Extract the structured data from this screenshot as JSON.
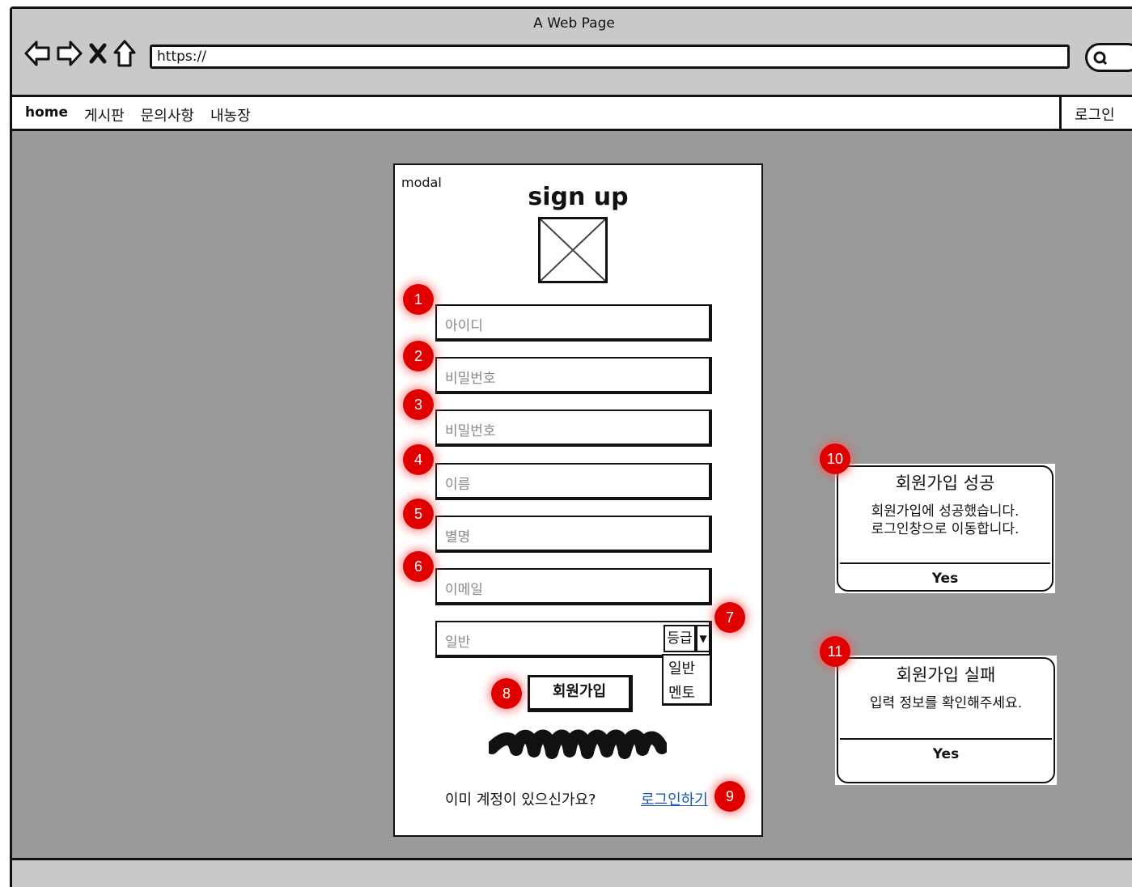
{
  "window": {
    "title": "A Web Page",
    "url": "https://"
  },
  "nav": {
    "items": [
      "home",
      "게시판",
      "문의사항",
      "내농장"
    ],
    "login": "로그인",
    "more": "..."
  },
  "modal": {
    "tag": "modal",
    "title": "sign up",
    "fields": [
      {
        "badge": "1",
        "placeholder": "아이디"
      },
      {
        "badge": "2",
        "placeholder": "비밀번호"
      },
      {
        "badge": "3",
        "placeholder": "비밀번호"
      },
      {
        "badge": "4",
        "placeholder": "이름"
      },
      {
        "badge": "5",
        "placeholder": "별명"
      },
      {
        "badge": "6",
        "placeholder": "이메일"
      }
    ],
    "grade": {
      "badge": "7",
      "value": "일반",
      "button": "등급",
      "options": [
        "일반",
        "멘토"
      ]
    },
    "signup_button": {
      "badge": "8",
      "label": "회원가입"
    },
    "footer": {
      "badge": "9",
      "question": "이미 계정이 있으신가요?",
      "link": "로그인하기"
    }
  },
  "alerts": [
    {
      "badge": "10",
      "title": "회원가입 성공",
      "lines": [
        "회원가입에 성공했습니다.",
        "로그인창으로 이동합니다."
      ],
      "button": "Yes"
    },
    {
      "badge": "11",
      "title": "회원가입 실패",
      "lines": [
        "입력 정보를 확인해주세요."
      ],
      "button": "Yes"
    }
  ],
  "colors": {
    "badge": "#e00000",
    "link": "#1a56b5",
    "backdrop": "#9a9a9a"
  }
}
